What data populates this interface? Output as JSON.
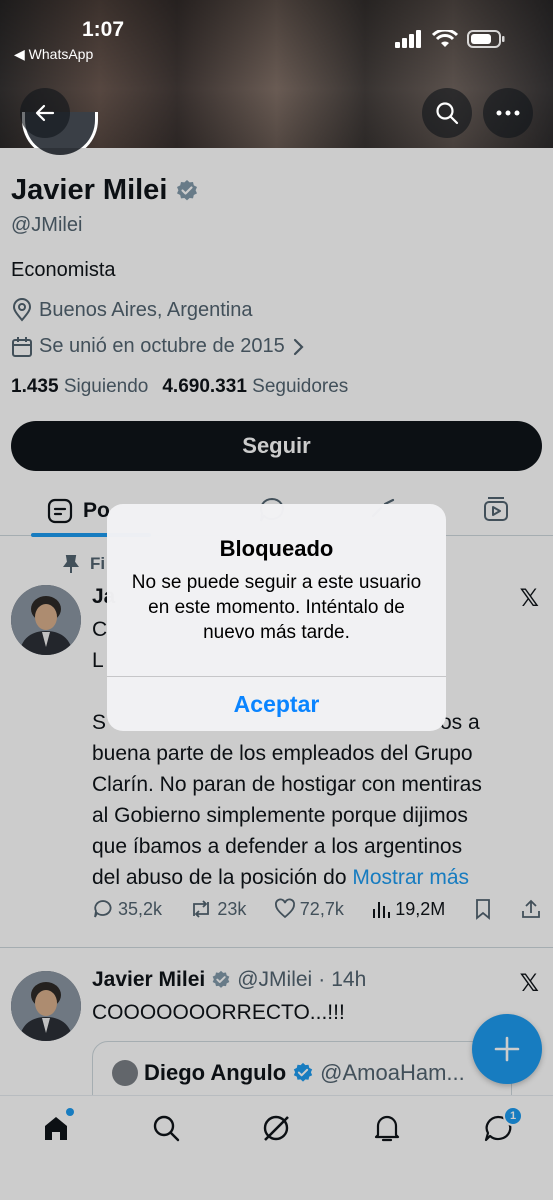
{
  "status_bar": {
    "time": "1:07",
    "back_app": "◀ WhatsApp"
  },
  "profile": {
    "name": "Javier Milei",
    "handle": "@JMilei",
    "bio": "Economista",
    "location": "Buenos Aires, Argentina",
    "joined": "Se unió en octubre de 2015",
    "following_count": "1.435",
    "following_label": "Siguiendo",
    "followers_count": "4.690.331",
    "followers_label": "Seguidores",
    "follow_button": "Seguir"
  },
  "tabs": {
    "first_visible": "Po"
  },
  "pinned_post": {
    "pinned_label": "Fi",
    "name_fragment": "Ja",
    "line1_fragment": "C",
    "line2_fragment": "L",
    "line3_start": "S",
    "line3_end": "os a",
    "lines": [
      "buena parte de los empleados del Grupo",
      "Clarín. No paran de hostigar con mentiras",
      "al Gobierno simplemente porque dijimos",
      "que íbamos a defender a los argentinos",
      "del abuso de la posición do"
    ],
    "show_more": "Mostrar más",
    "replies": "35,2k",
    "reposts": "23k",
    "likes": "72,7k",
    "views": "19,2M"
  },
  "second_post": {
    "name": "Javier Milei",
    "handle": "@JMilei",
    "dot": "·",
    "time": "14h",
    "text": "COOOOOOORRECTO...!!!",
    "quoted_name": "Diego Angulo",
    "quoted_handle": "@AmoaHam..."
  },
  "alert": {
    "title": "Bloqueado",
    "message": "No se puede seguir a este usuario en este momento. Inténtalo de nuevo más tarde.",
    "button": "Aceptar"
  },
  "tabbar": {
    "messages_badge": "1"
  },
  "colors": {
    "accent": "#1d9bf0",
    "ios_blue": "#0a84ff",
    "verified": "#829aab"
  }
}
